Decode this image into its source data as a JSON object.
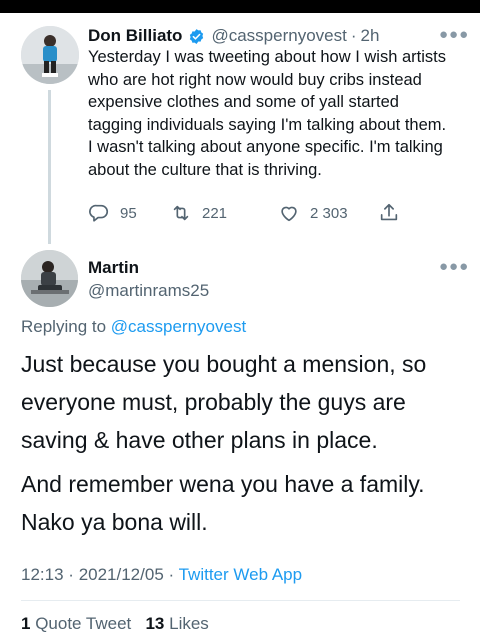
{
  "status_bar": {
    "color": "#000000"
  },
  "parent_tweet": {
    "display_name": "Don Billiato",
    "handle": "@casspernyovest",
    "separator": "·",
    "time": "2h",
    "text": "Yesterday I was tweeting about how I wish artists who are hot right now would buy cribs instead expensive clothes and some of yall started tagging individuals saying I'm talking about them. I wasn't talking about anyone specific. I'm talking about the culture that is thriving.",
    "replies": "95",
    "retweets": "221",
    "likes": "2 303",
    "verified": true
  },
  "reply_tweet": {
    "display_name": "Martin",
    "handle": "@martinrams25",
    "replying_prefix": "Replying to",
    "replying_to": "@casspernyovest",
    "paragraph_1": "Just because you bought a mension, so everyone must, probably the guys are saving & have other plans in place.",
    "paragraph_2": "And remember wena you have a family. Nako ya bona will.",
    "time": "12:13",
    "date": "2021/12/05",
    "separator": "·",
    "source": "Twitter Web App",
    "quote_count": "1",
    "quote_label": "Quote Tweet",
    "likes_count": "13",
    "likes_label": "Likes"
  },
  "icons": {
    "more": "more-options-icon",
    "reply": "reply-icon",
    "retweet": "retweet-icon",
    "like": "heart-icon",
    "share": "share-icon",
    "verified": "verified-badge-icon"
  },
  "colors": {
    "accent": "#1d9bf0",
    "muted": "#536471",
    "text": "#0f1419"
  }
}
